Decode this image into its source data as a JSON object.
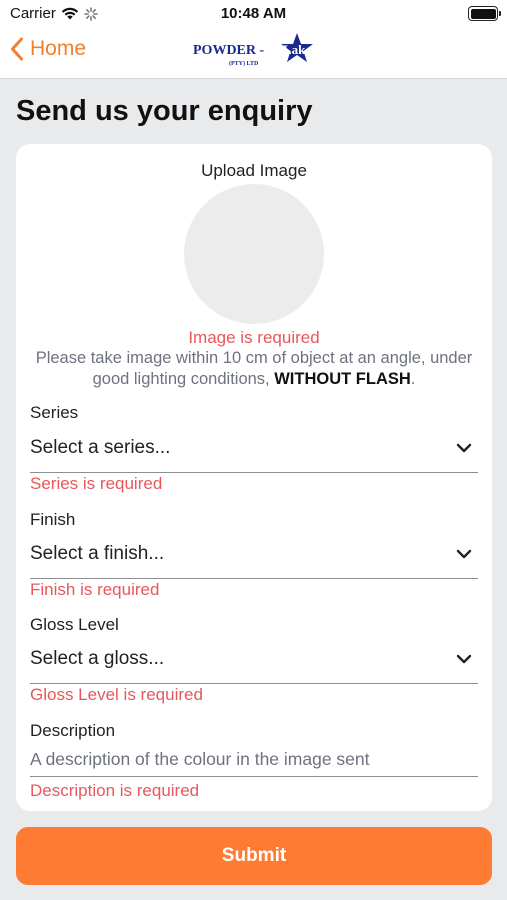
{
  "status_bar": {
    "carrier": "Carrier",
    "time": "10:48 AM"
  },
  "nav": {
    "back_label": "Home",
    "logo_text_main": "POWDER - ",
    "logo_text_star": "Lak",
    "logo_subtext": "(PTY) LTD"
  },
  "page": {
    "title": "Send us your enquiry"
  },
  "upload": {
    "label": "Upload Image",
    "error": "Image is required",
    "instructions_prefix": "Please take image within 10 cm of object at an angle, under good lighting conditions, ",
    "instructions_bold": "WITHOUT FLASH",
    "instructions_suffix": "."
  },
  "fields": {
    "series": {
      "label": "Series",
      "value": "Select a series...",
      "error": "Series is required"
    },
    "finish": {
      "label": "Finish",
      "value": "Select a finish...",
      "error": "Finish is required"
    },
    "gloss": {
      "label": "Gloss Level",
      "value": "Select a gloss...",
      "error": "Gloss Level is required"
    },
    "description": {
      "label": "Description",
      "placeholder": "A description of the colour in the image sent",
      "value": "",
      "error": "Description is required"
    }
  },
  "submit_label": "Submit",
  "colors": {
    "accent": "#f07f2e",
    "button": "#fd7b32",
    "error": "#e8575b",
    "logo_blue": "#1a2a8c"
  }
}
